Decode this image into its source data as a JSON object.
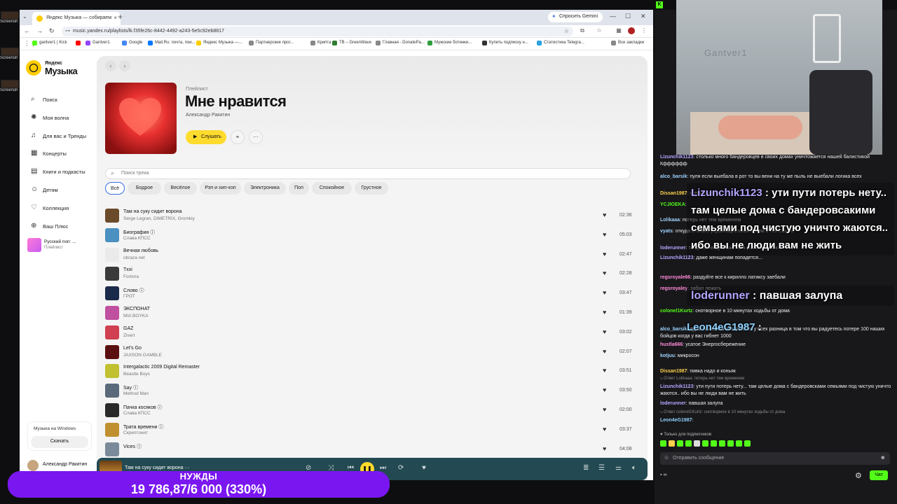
{
  "desktop": {
    "icons": [
      "Screensh",
      "Screensh",
      "Screensh"
    ]
  },
  "browser": {
    "tab_title": "Яндекс Музыка — собираем",
    "gemini_label": "Спросить Gemini",
    "url": "music.yandex.ru/playlists/lk.f35fe26c-8442-4492-a243-5e5c92eb8817",
    "bookmarks": [
      {
        "label": "gantver1 | Kick",
        "color": "#53fc18"
      },
      {
        "label": "",
        "color": "#ff0000"
      },
      {
        "label": "Gantver1",
        "color": "#9146ff"
      },
      {
        "label": "Google",
        "color": "#4285f4"
      },
      {
        "label": "Mail.Ru: почта, пои...",
        "color": "#0077ff"
      },
      {
        "label": "Яндекс Музыка —...",
        "color": "#ffcc00"
      },
      {
        "label": "Партнерские прог...",
        "color": "#888888"
      },
      {
        "label": "Крипта",
        "color": "#888888"
      },
      {
        "label": "TB – GreenWave",
        "color": "#2e7d32"
      },
      {
        "label": "Главная - DonatePa...",
        "color": "#888888"
      },
      {
        "label": "Мужские ботинки...",
        "color": "#2e9e3e"
      },
      {
        "label": "Купить подписку н...",
        "color": "#333333"
      },
      {
        "label": "Статистика Telegra...",
        "color": "#2aa3e0"
      },
      {
        "label": "Все закладки",
        "color": "#888888"
      }
    ]
  },
  "sidebar": {
    "logo_line1": "Яндекс",
    "logo_line2": "Музыка",
    "items": [
      {
        "label": "Поиск",
        "icon": "⌕"
      },
      {
        "label": "Моя волна",
        "icon": "✺"
      },
      {
        "label": "Для вас и Тренды",
        "icon": "♫"
      },
      {
        "label": "Концерты",
        "icon": "▦"
      },
      {
        "label": "Книги и подкасты",
        "icon": "▤"
      },
      {
        "label": "Детям",
        "icon": "☺"
      },
      {
        "label": "Коллекция",
        "icon": "♡"
      },
      {
        "label": "Ваш Плюс",
        "icon": "⊕"
      }
    ],
    "pinned_playlist": {
      "name": "Русский поп: ...",
      "sub": "Плейлист"
    },
    "promo_text": "Музыка на Windows",
    "promo_button": "Скачать",
    "user_name": "Александр Ракитин"
  },
  "playlist": {
    "type_label": "Плейлист",
    "title": "Мне нравится",
    "owner": "Александр Ракитин",
    "listen_label": "Слушать",
    "search_placeholder": "Поиск трека",
    "chips": [
      "Всё",
      "Бодрое",
      "Весёлое",
      "Рэп и хип-хоп",
      "Электроника",
      "Поп",
      "Спокойное",
      "Грустное"
    ],
    "tracks": [
      {
        "title": "Там на суку сидит ворона",
        "artist": "Serge Legran, DIMETRIX, Gromkiy",
        "duration": "02:36",
        "color": "#6b4a2a"
      },
      {
        "title": "Биография ⓘ",
        "artist": "Слава КПСС",
        "duration": "05:03",
        "color": "#4a90c0"
      },
      {
        "title": "Вечная любовь",
        "artist": "obraza net",
        "duration": "02:47",
        "color": "#eaeaea"
      },
      {
        "title": "Txxi",
        "artist": "Fortxna",
        "duration": "02:28",
        "color": "#3a3a3a"
      },
      {
        "title": "Слово ⓘ",
        "artist": "ГРОТ",
        "duration": "03:47",
        "color": "#1a2a4a"
      },
      {
        "title": "ЭКСПОНАТ",
        "artist": "MIA BOYKA",
        "duration": "01:39",
        "color": "#c050a0"
      },
      {
        "title": "GAZ",
        "artist": "Zivert",
        "duration": "03:02",
        "color": "#d04050"
      },
      {
        "title": "Let's Go",
        "artist": "JAXSON GAMBLE",
        "duration": "02:07",
        "color": "#5a1010"
      },
      {
        "title": "Intergalactic 2009 Digital Remaster",
        "artist": "Beastie Boys",
        "duration": "03:51",
        "color": "#c0c030"
      },
      {
        "title": "Say ⓘ",
        "artist": "Method Man",
        "duration": "03:50",
        "color": "#5a6a7a"
      },
      {
        "title": "Пачка косяков ⓘ",
        "artist": "Слава КПСС",
        "duration": "02:00",
        "color": "#2a2a2a"
      },
      {
        "title": "Трата времени ⓘ",
        "artist": "Скриптонит",
        "duration": "03:37",
        "color": "#c09030"
      },
      {
        "title": "Vices ⓘ",
        "artist": "",
        "duration": "04:08",
        "color": "#7a8a9a"
      }
    ]
  },
  "player": {
    "now_playing": "Там на суку сидит ворона ···"
  },
  "chat": {
    "webcam_logo": "Gantver1",
    "messages": [
      {
        "kind": "msg",
        "user": "Lizunchik1123",
        "text": "столько много бандеровцев в своих домах уничтожается нашей балистикой",
        "color": "#b4a6ff"
      },
      {
        "kind": "msg",
        "user": "",
        "text": "Кфффффф",
        "color": "#efeff1"
      },
      {
        "kind": "msg",
        "user": "alco_barsik",
        "text": "пуля если выебала в рот то вы вени на ту же пыль не выебали логика всех",
        "color": "#9fd4ff"
      },
      {
        "kind": "msg",
        "user": "Dissan1987",
        "text": "ксений пусть",
        "color": "#ffd24a"
      },
      {
        "kind": "msg",
        "user": "YCJIOEKA",
        "text": "",
        "color": "#53fc18"
      },
      {
        "kind": "msg",
        "user": "Lolikaaa",
        "text": "потерь нет тем временем",
        "color": "#9fd4ff"
      },
      {
        "kind": "msg",
        "user": "vyats",
        "text": "откуда столько украинацистской мрази в тех Сашко",
        "color": "#9fd4ff"
      },
      {
        "kind": "msg",
        "user": "loderunner",
        "text": "ты даже не думный, ты в ротоверунчик",
        "color": "#b4a6ff"
      },
      {
        "kind": "msg",
        "user": "Lizunchik1123",
        "text": "даже женщинам попадется...",
        "color": "#b4a6ff"
      },
      {
        "kind": "msg",
        "user": "regsroyale66",
        "text": "раздуйте все к кирилло латиксу заебали",
        "color": "#ff8ad8"
      },
      {
        "kind": "msg",
        "user": "regsroyaley",
        "text": "забал лежать",
        "color": "#ff8ad8"
      },
      {
        "kind": "msg",
        "user": "colonel1Kurtz",
        "text": "снотворное в 10 минутах ходьбы от дома",
        "color": "#53fc18"
      },
      {
        "kind": "msg",
        "user": "alco_barsik",
        "text": "дура это война потери есть у всех разница в том что вы радуетесь потере 100 наших бойцов когда у вас гибнет 1000",
        "color": "#9fd4ff"
      },
      {
        "kind": "msg",
        "user": "hustla666",
        "text": "усатое Энергосбережение",
        "color": "#ff8ad8"
      },
      {
        "kind": "msg",
        "user": "kotjuu",
        "text": "микросон",
        "color": "#9fd4ff"
      },
      {
        "kind": "msg",
        "user": "Dissan1987",
        "text": "пивка надо и коньяк",
        "color": "#ffd24a"
      },
      {
        "kind": "reply",
        "user": "",
        "text": "Ответ Lolikaaa: потерь нет тем временем",
        "color": "#8a8a8f"
      },
      {
        "kind": "msg",
        "user": "Lizunchik1123",
        "text": "ути пути потерь нету... там целые дома с бандеровсками семьями под чистую уничто жаются.. ибо вы не люди вам не жить",
        "color": "#b4a6ff"
      },
      {
        "kind": "msg",
        "user": "loderunner",
        "text": "павшая залупа",
        "color": "#b4a6ff"
      },
      {
        "kind": "reply",
        "user": "",
        "text": "Ответ colonel1Kurtz: снотворное в 10 минутах ходьбы от дома",
        "color": "#8a8a8f"
      },
      {
        "kind": "msg",
        "user": "Leon4eG1987",
        "text": "",
        "color": "#8fd1ff"
      }
    ],
    "overlay": [
      {
        "user": "Lizunchik1123",
        "text": "ути пути потерь нету.. там целые дома с бандеровсакими семьями под чистую уничто жаются.. ибо вы не люди вам не жить"
      },
      {
        "user": "loderunner",
        "text": "павшая залупа"
      },
      {
        "user": "Leon4eG1987",
        "text": ""
      }
    ],
    "sub_only_label": "Только для подписчиков",
    "send_placeholder": "Отправить сообщение",
    "chat_button": "Чат",
    "viewer_count": "∞"
  },
  "donation": {
    "label": "НУЖДЫ",
    "amount": "19 786,87/6 000 (330%)",
    "progress_percent": 330
  }
}
